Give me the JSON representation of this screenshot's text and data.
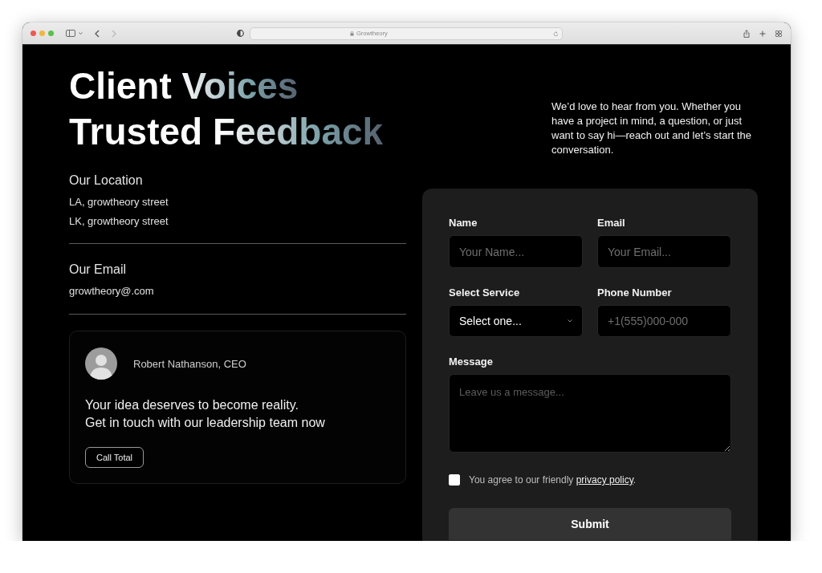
{
  "browser": {
    "nav": [
      {
        "kind": "back",
        "disabled": false
      },
      {
        "kind": "forward",
        "disabled": true
      }
    ],
    "address": "Growtheory"
  },
  "hero": {
    "title": "Client Voices\nTrusted Feedback",
    "intro": "We’d love to hear from you. Whether you have a project in mind, a question, or just want to say hi—reach out and let’s start the conversation."
  },
  "contact_info": [
    {
      "heading": "Our Location",
      "lines": [
        "LA, growtheory street",
        "LK, growtheory street"
      ]
    },
    {
      "heading": "Our Email",
      "lines": [
        "growtheory@.com"
      ]
    }
  ],
  "leader_card": {
    "name": "Robert Nathanson, CEO",
    "message": "Your idea deserves to become reality.\nGet in touch with our leadership team now",
    "button": "Call Total"
  },
  "form": {
    "fields": [
      {
        "kind": "input",
        "label": "Name",
        "placeholder": "Your Name..."
      },
      {
        "kind": "input",
        "label": "Email",
        "placeholder": "Your Email..."
      },
      {
        "kind": "select",
        "label": "Select Service",
        "value": "Select one..."
      },
      {
        "kind": "input",
        "label": "Phone Number",
        "placeholder": "+1(555)000-000"
      },
      {
        "kind": "textarea",
        "label": "Message",
        "placeholder": "Leave us a message..."
      }
    ],
    "consent": {
      "checked": false,
      "text": "You agree to our friendly ",
      "link": "privacy policy",
      "after": "."
    },
    "submit": "Submit"
  }
}
